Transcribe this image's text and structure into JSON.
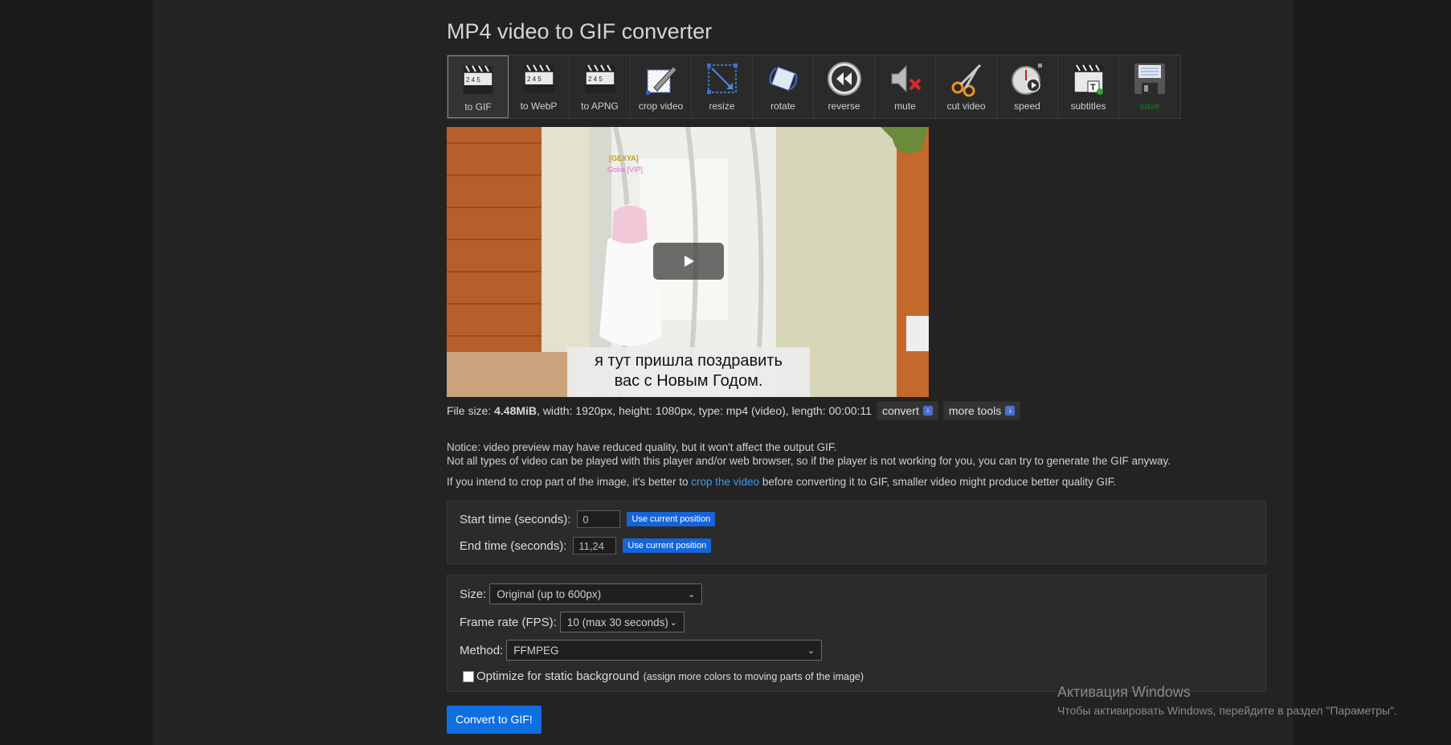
{
  "title": "MP4 video to GIF converter",
  "toolbar": [
    {
      "label": "to GIF",
      "icon": "clapperboard-icon",
      "active": true
    },
    {
      "label": "to WebP",
      "icon": "clapperboard-icon"
    },
    {
      "label": "to APNG",
      "icon": "clapperboard-icon"
    },
    {
      "label": "crop video",
      "icon": "crop-icon"
    },
    {
      "label": "resize",
      "icon": "resize-icon"
    },
    {
      "label": "rotate",
      "icon": "rotate-icon"
    },
    {
      "label": "reverse",
      "icon": "rewind-icon"
    },
    {
      "label": "mute",
      "icon": "speaker-mute-icon"
    },
    {
      "label": "cut video",
      "icon": "scissors-icon"
    },
    {
      "label": "speed",
      "icon": "stopwatch-icon"
    },
    {
      "label": "subtitles",
      "icon": "subtitles-icon"
    },
    {
      "label": "save",
      "icon": "floppy-disk-icon"
    }
  ],
  "video": {
    "overlay_tag": "[GEXYA]",
    "overlay_name": "Goba [VIP]",
    "subtitle_line1": "я тут пришла поздравить",
    "subtitle_line2": "вас с Новым Годом."
  },
  "fileinfo": {
    "prefix": "File size: ",
    "size": "4.48MiB",
    "rest": ", width: 1920px, height: 1080px, type: mp4 (video), length: 00:00:11",
    "convert_label": "convert",
    "more_tools_label": "more tools"
  },
  "notice": {
    "line1": "Notice: video preview may have reduced quality, but it won't affect the output GIF.",
    "line2": "Not all types of video can be played with this player and/or web browser, so if the player is not working for you, you can try to generate the GIF anyway.",
    "line3_pre": "If you intend to crop part of the image, it's better to ",
    "line3_link": "crop the video",
    "line3_post": " before converting it to GIF, smaller video might produce better quality GIF."
  },
  "timing": {
    "start_label": "Start time (seconds):",
    "start_value": "0",
    "end_label": "End time (seconds):",
    "end_value": "11,24",
    "use_current": "Use current position"
  },
  "options": {
    "size_label": "Size:",
    "size_value": "Original (up to 600px)",
    "fps_label": "Frame rate (FPS):",
    "fps_value": "10 (max 30 seconds)",
    "method_label": "Method:",
    "method_value": "FFMPEG",
    "optimize_label": "Optimize for static background",
    "optimize_hint": "(assign more colors to moving parts of the image)"
  },
  "convert_button": "Convert to GIF!",
  "watermark": {
    "line1": "Активация Windows",
    "line2": "Чтобы активировать Windows, перейдите в раздел \"Параметры\"."
  },
  "colors": {
    "accent": "#1565d8",
    "link": "#3d9be9",
    "save_label": "#1f7a1f"
  }
}
